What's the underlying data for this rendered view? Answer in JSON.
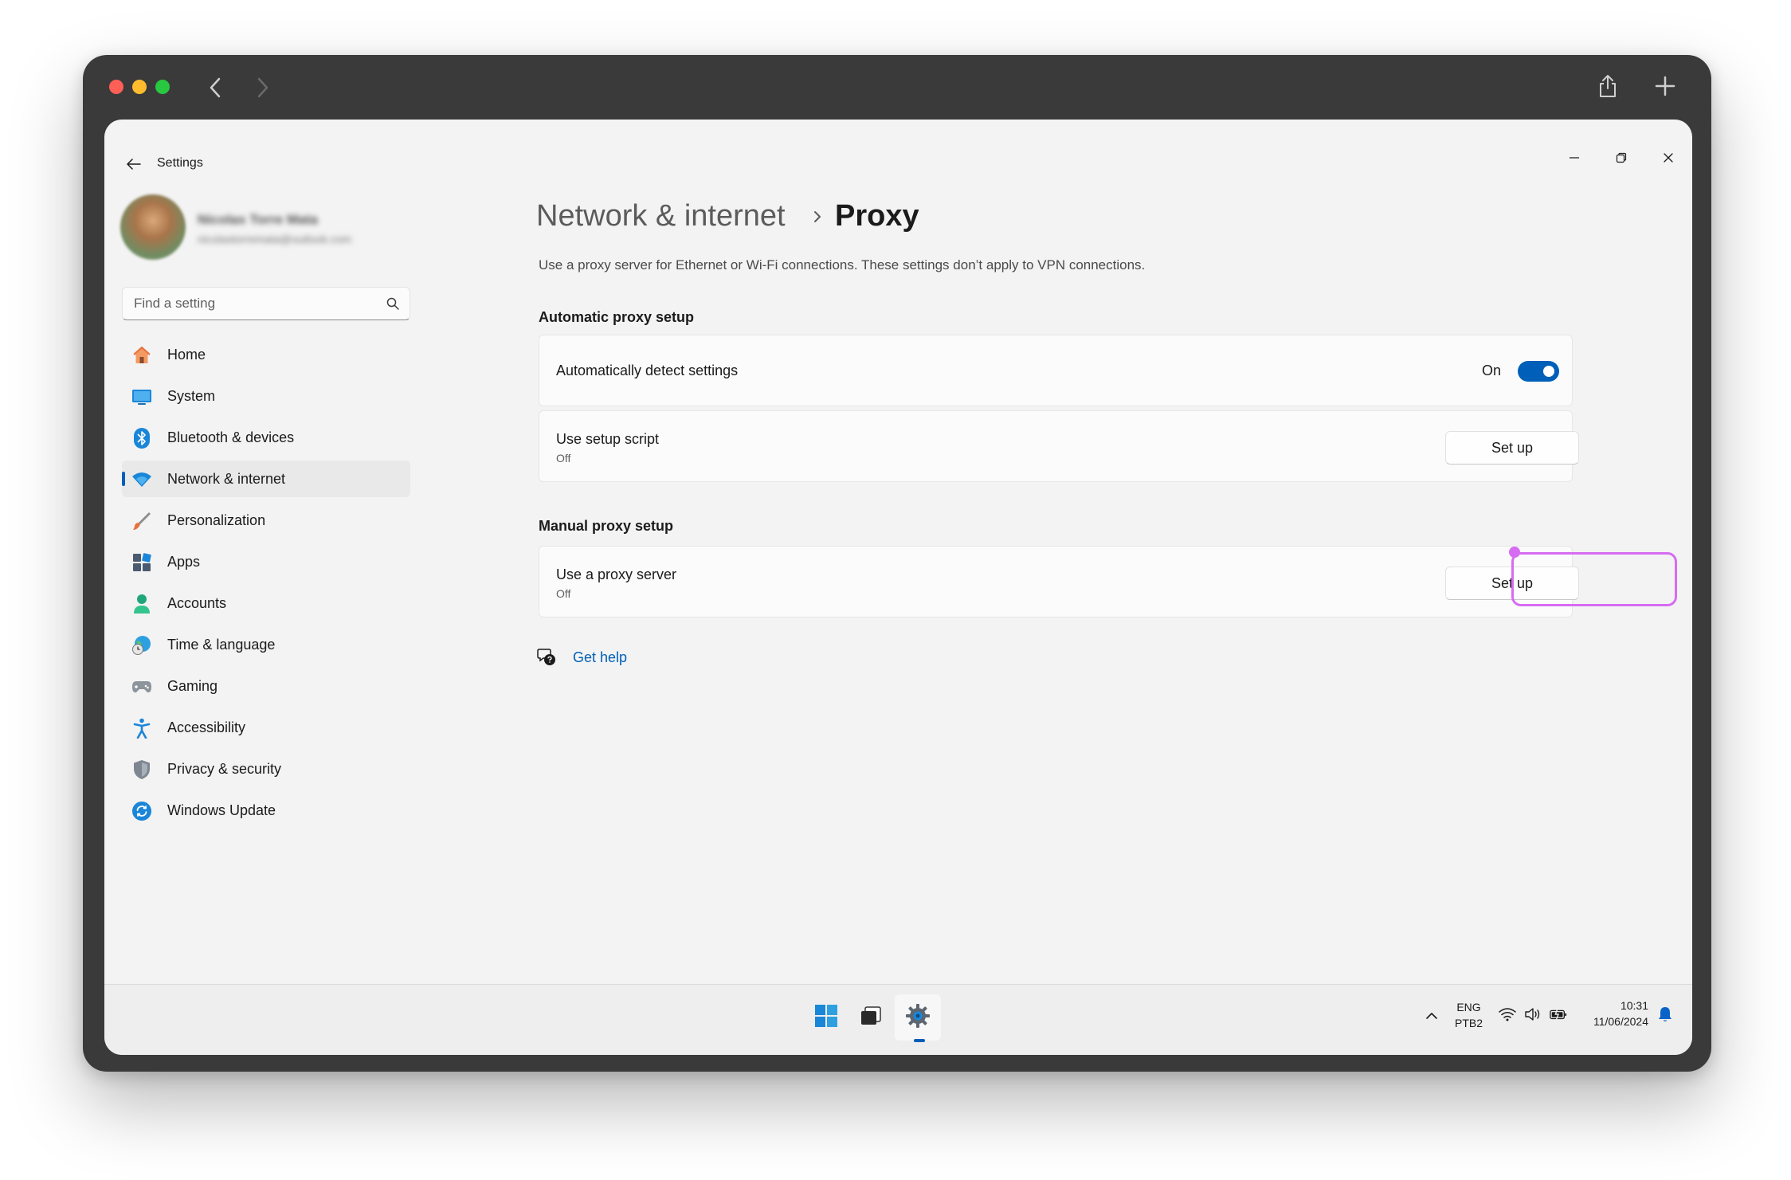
{
  "window": {
    "title": "Settings"
  },
  "user": {
    "name": "Nicolas Torre Mata",
    "email": "nicolastorremata@outlook.com"
  },
  "search": {
    "placeholder": "Find a setting"
  },
  "sidebar": {
    "items": [
      {
        "label": "Home",
        "icon": "home-icon"
      },
      {
        "label": "System",
        "icon": "system-icon"
      },
      {
        "label": "Bluetooth & devices",
        "icon": "bluetooth-icon"
      },
      {
        "label": "Network & internet",
        "icon": "wifi-icon",
        "active": true
      },
      {
        "label": "Personalization",
        "icon": "brush-icon"
      },
      {
        "label": "Apps",
        "icon": "apps-icon"
      },
      {
        "label": "Accounts",
        "icon": "accounts-icon"
      },
      {
        "label": "Time & language",
        "icon": "globe-clock-icon"
      },
      {
        "label": "Gaming",
        "icon": "gamepad-icon"
      },
      {
        "label": "Accessibility",
        "icon": "accessibility-icon"
      },
      {
        "label": "Privacy & security",
        "icon": "shield-icon"
      },
      {
        "label": "Windows Update",
        "icon": "update-icon"
      }
    ]
  },
  "breadcrumb": {
    "parent": "Network & internet",
    "current": "Proxy"
  },
  "main": {
    "description": "Use a proxy server for Ethernet or Wi-Fi connections. These settings don’t apply to VPN connections.",
    "automatic": {
      "title": "Automatic proxy setup",
      "detect": {
        "label": "Automatically detect settings",
        "state": "On"
      },
      "script": {
        "label": "Use setup script",
        "status": "Off",
        "button": "Set up"
      }
    },
    "manual": {
      "title": "Manual proxy setup",
      "proxy": {
        "label": "Use a proxy server",
        "status": "Off",
        "button": "Set up"
      }
    },
    "help": {
      "label": "Get help"
    }
  },
  "taskbar": {
    "lang_line1": "ENG",
    "lang_line2": "PTB2",
    "time": "10:31",
    "date": "11/06/2024"
  },
  "colors": {
    "accent": "#005fb8",
    "highlight": "#d66cf2",
    "window_bg": "#f3f3f3",
    "frame": "#3a3a3a"
  }
}
